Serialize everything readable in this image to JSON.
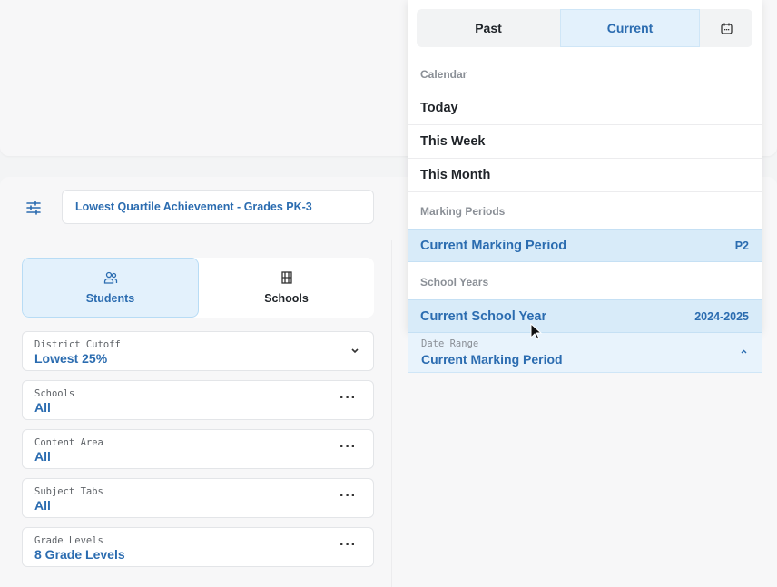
{
  "header": {
    "report_title": "Lowest Quartile Achievement - Grades PK-3"
  },
  "toggle": {
    "students_label": "Students",
    "schools_label": "Schools"
  },
  "filters": {
    "district_cutoff": {
      "label": "District Cutoff",
      "value": "Lowest 25%"
    },
    "schools": {
      "label": "Schools",
      "value": "All"
    },
    "content_area": {
      "label": "Content Area",
      "value": "All"
    },
    "subject_tabs": {
      "label": "Subject Tabs",
      "value": "All"
    },
    "grade_levels": {
      "label": "Grade Levels",
      "value": "8 Grade Levels"
    },
    "more_glyph": "···"
  },
  "dropdown": {
    "past_label": "Past",
    "current_label": "Current",
    "calendar_section": "Calendar",
    "today": "Today",
    "this_week": "This Week",
    "this_month": "This Month",
    "marking_periods_section": "Marking Periods",
    "current_marking_period": "Current Marking Period",
    "current_marking_period_tag": "P2",
    "school_years_section": "School Years",
    "current_school_year": "Current School Year",
    "current_school_year_tag": "2024-2025"
  },
  "date_range": {
    "label": "Date Range",
    "value": "Current Marking Period"
  },
  "colors": {
    "accent": "#2b6cb0",
    "selected_bg": "#d8ebf9",
    "active_toggle_bg": "#e3f1fc"
  },
  "icons": {
    "filter": "sliders-icon",
    "students": "users-icon",
    "schools": "building-icon",
    "calendar": "calendar-icon",
    "dropdown": "chevron-down-icon",
    "date_range": "chevron-up-icon",
    "more": "more-horizontal-icon"
  }
}
